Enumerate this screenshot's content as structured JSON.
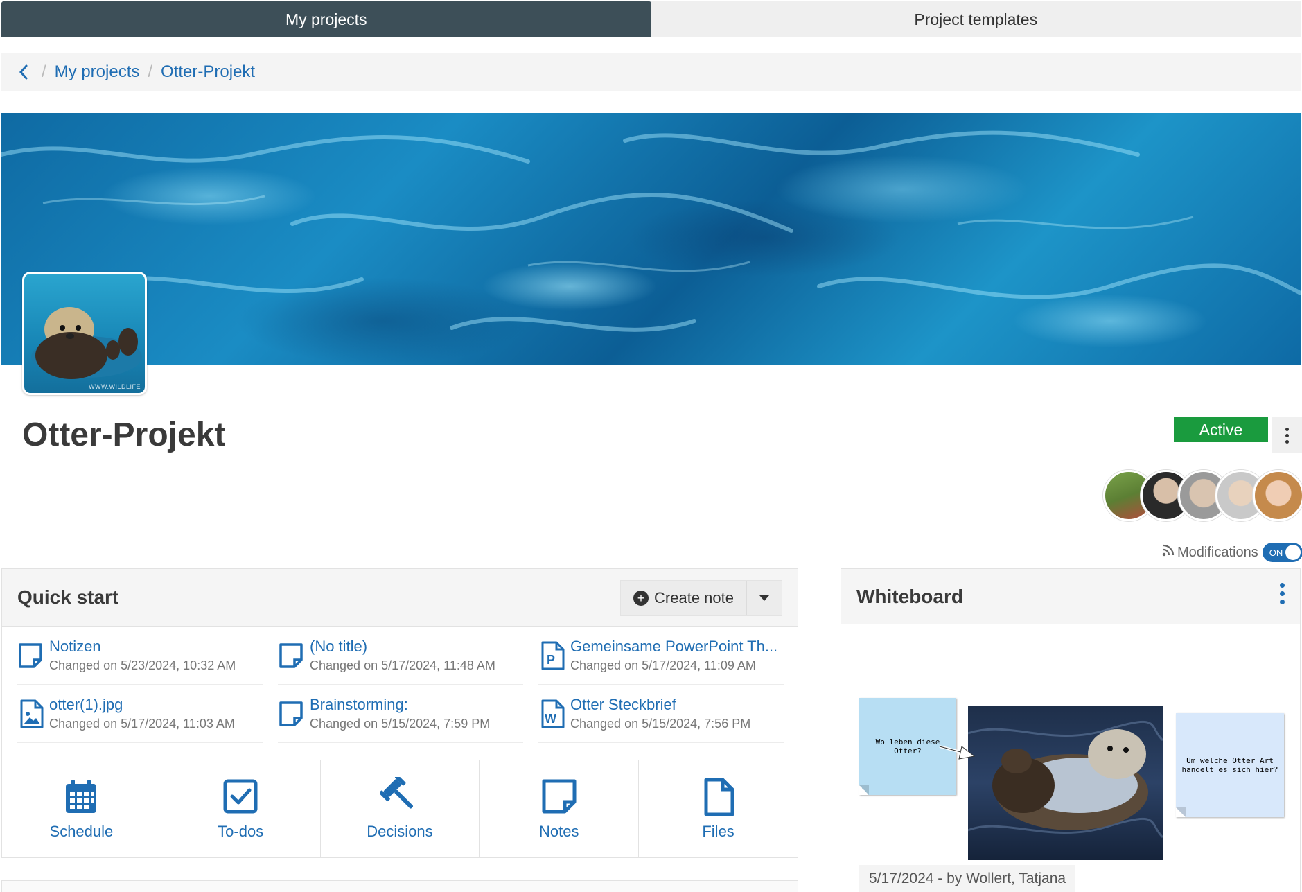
{
  "tabs": [
    {
      "label": "My projects",
      "active": true
    },
    {
      "label": "Project templates",
      "active": false
    }
  ],
  "breadcrumb": {
    "items": [
      "My projects",
      "Otter-Projekt"
    ]
  },
  "project": {
    "title": "Otter-Projekt",
    "status": "Active",
    "avatar_watermark": "WWW.WILDLIFE",
    "members_count": 5
  },
  "modifications": {
    "label": "Modifications",
    "toggle": "ON"
  },
  "quick_start": {
    "title": "Quick start",
    "create_label": "Create note",
    "files": [
      {
        "name": "Notizen",
        "date": "Changed on 5/23/2024, 10:32 AM",
        "icon": "note-icon"
      },
      {
        "name": "(No title)",
        "date": "Changed on 5/17/2024, 11:48 AM",
        "icon": "note-icon"
      },
      {
        "name": "Gemeinsame PowerPoint Th...",
        "date": "Changed on 5/17/2024, 11:09 AM",
        "icon": "powerpoint-file-icon"
      },
      {
        "name": "otter(1).jpg",
        "date": "Changed on 5/17/2024, 11:03 AM",
        "icon": "image-file-icon"
      },
      {
        "name": "Brainstorming:",
        "date": "Changed on 5/15/2024, 7:59 PM",
        "icon": "note-icon"
      },
      {
        "name": "Otter Steckbrief",
        "date": "Changed on 5/15/2024, 7:56 PM",
        "icon": "word-file-icon"
      }
    ],
    "shortcuts": [
      {
        "label": "Schedule",
        "icon": "calendar-icon"
      },
      {
        "label": "To-dos",
        "icon": "checkbox-icon"
      },
      {
        "label": "Decisions",
        "icon": "gavel-icon"
      },
      {
        "label": "Notes",
        "icon": "note-icon"
      },
      {
        "label": "Files",
        "icon": "file-icon"
      }
    ]
  },
  "whiteboard": {
    "title": "Whiteboard",
    "sticky1": "Wo leben diese Otter?",
    "sticky2": "Um welche Otter Art handelt es sich hier?",
    "footer": "5/17/2024 - by Wollert, Tatjana"
  },
  "colors": {
    "accent": "#1f6db3",
    "tab_active": "#3d4f58",
    "status_active": "#1a9b3e"
  }
}
